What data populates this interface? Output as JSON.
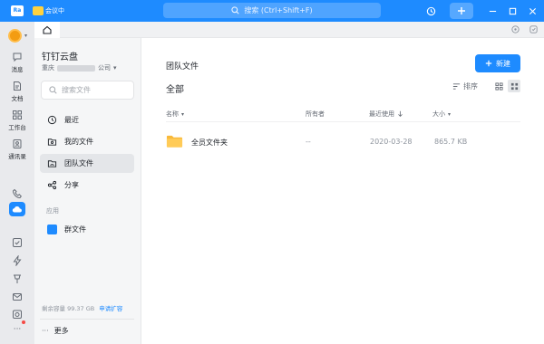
{
  "titlebar": {
    "app_badge": "Ra",
    "meeting_label": "会议中",
    "search_placeholder": "搜索 (Ctrl+Shift+F)",
    "accent": "#1e8bff"
  },
  "nav_rail": {
    "items": [
      {
        "label": "消息",
        "icon": "message-icon"
      },
      {
        "label": "文档",
        "icon": "doc-icon"
      },
      {
        "label": "工作台",
        "icon": "workbench-icon"
      },
      {
        "label": "通讯录",
        "icon": "contacts-icon"
      }
    ],
    "more_label": "···"
  },
  "sidebar": {
    "title": "钉钉云盘",
    "org_prefix": "重庆",
    "org_suffix": "公司",
    "search_placeholder": "搜索文件",
    "items": [
      {
        "label": "最近",
        "icon": "clock-icon"
      },
      {
        "label": "我的文件",
        "icon": "my-files-icon"
      },
      {
        "label": "团队文件",
        "icon": "team-files-icon",
        "active": true
      },
      {
        "label": "分享",
        "icon": "share-icon"
      }
    ],
    "apps_section": "应用",
    "apps": [
      {
        "label": "群文件",
        "icon": "group-files-icon"
      }
    ],
    "storage_text": "剩余容量 99.37 GB",
    "expand_link": "申请扩容",
    "more_label": "更多"
  },
  "main": {
    "page_title": "团队文件",
    "new_button": "新建",
    "breadcrumb": "全部",
    "sort_label": "排序",
    "columns": {
      "name": "名称",
      "owner": "所有者",
      "last_used": "最近使用",
      "size": "大小"
    },
    "rows": [
      {
        "name": "全员文件夹",
        "owner": "--",
        "last_used": "2020-03-28",
        "size": "865.7 KB"
      }
    ]
  }
}
